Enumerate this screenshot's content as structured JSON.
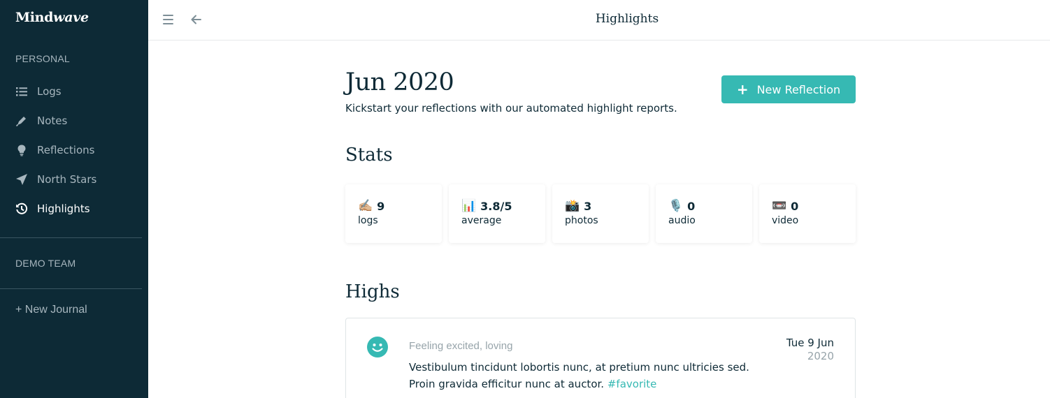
{
  "sidebar": {
    "brand": {
      "part1": "Mind",
      "part2": "wave"
    },
    "personal_label": "PERSONAL",
    "items": [
      {
        "label": "Logs",
        "icon": "list-icon"
      },
      {
        "label": "Notes",
        "icon": "pen-icon"
      },
      {
        "label": "Reflections",
        "icon": "lightbulb-icon"
      },
      {
        "label": "North Stars",
        "icon": "paper-plane-icon"
      },
      {
        "label": "Highlights",
        "icon": "history-icon",
        "active": true
      }
    ],
    "team_label": "DEMO TEAM",
    "new_journal": "+ New Journal"
  },
  "topbar": {
    "title": "Highlights"
  },
  "main": {
    "month": "Jun 2020",
    "subtitle": "Kickstart your reflections with our automated highlight reports.",
    "new_button": {
      "plus": "+",
      "label": "New Reflection"
    },
    "stats_heading": "Stats",
    "stats": [
      {
        "emoji": "✍🏼",
        "value": "9",
        "label": "logs"
      },
      {
        "emoji": "📊",
        "value": "3.8/5",
        "label": "average"
      },
      {
        "emoji": "📸",
        "value": "3",
        "label": "photos"
      },
      {
        "emoji": "🎙️",
        "value": "0",
        "label": "audio"
      },
      {
        "emoji": "📼",
        "value": "0",
        "label": "video"
      }
    ],
    "highs_heading": "Highs",
    "highs": [
      {
        "feeling": "Feeling excited, loving",
        "text": "Vestibulum tincidunt lobortis nunc, at pretium nunc ultricies sed. Proin gravida efficitur nunc at auctor.",
        "tag": "#favorite",
        "date_day": "Tue 9 Jun",
        "date_year": "2020"
      }
    ]
  },
  "colors": {
    "sidebar_bg": "#0d2a36",
    "accent": "#36b9b3",
    "text": "#0e2a36",
    "muted": "#97a4aa"
  }
}
